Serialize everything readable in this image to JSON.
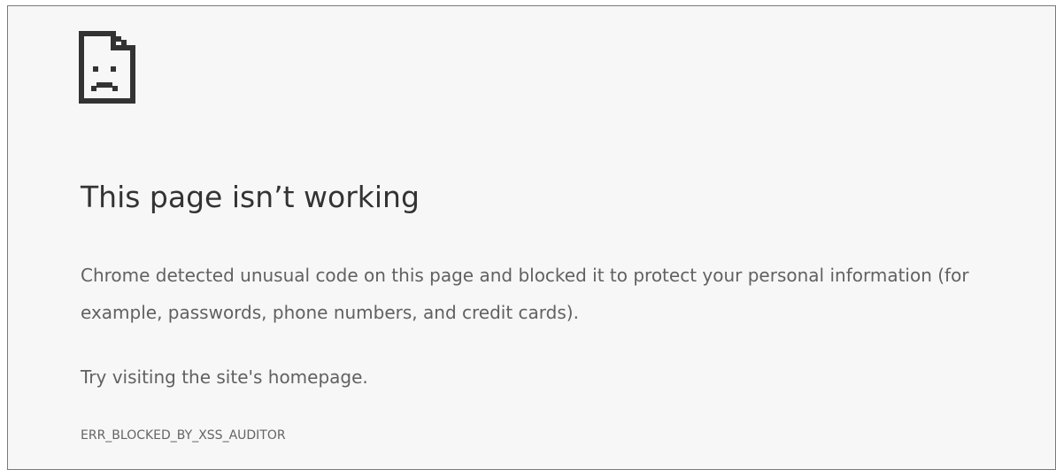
{
  "error_page": {
    "icon": "sad-page-icon",
    "title": "This page isn’t working",
    "message": "Chrome detected unusual code on this page and blocked it to protect your personal information (for example, passwords, phone numbers, and credit cards).",
    "suggestion": "Try visiting the site's homepage.",
    "error_code": "ERR_BLOCKED_BY_XSS_AUDITOR"
  },
  "colors": {
    "background": "#f7f7f7",
    "title_text": "#333333",
    "body_text": "#616161",
    "icon": "#333333"
  }
}
